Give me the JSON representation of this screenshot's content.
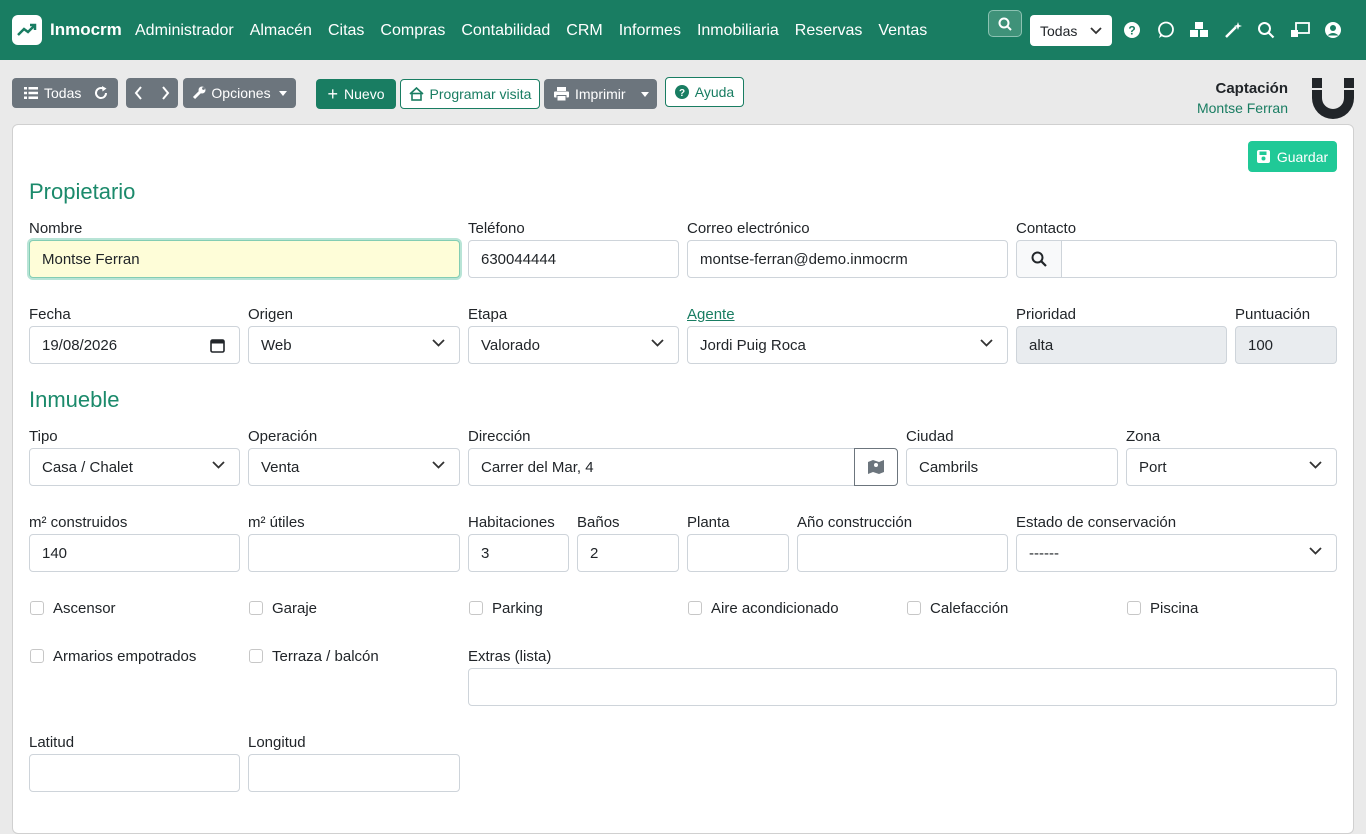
{
  "app": {
    "name": "Inmocrm"
  },
  "nav": [
    "Administrador",
    "Almacén",
    "Citas",
    "Compras",
    "Contabilidad",
    "CRM",
    "Informes",
    "Inmobiliaria",
    "Reservas",
    "Ventas"
  ],
  "top_select": "Todas",
  "toolbar": {
    "todas": "Todas",
    "opciones": "Opciones",
    "nuevo": "Nuevo",
    "programar": "Programar visita",
    "imprimir": "Imprimir",
    "ayuda": "Ayuda"
  },
  "header": {
    "title": "Captación",
    "subtitle": "Montse Ferran"
  },
  "save_label": "Guardar",
  "propietario": {
    "title": "Propietario",
    "nombre_label": "Nombre",
    "nombre": "Montse Ferran",
    "telefono_label": "Teléfono",
    "telefono": "630044444",
    "correo_label": "Correo electrónico",
    "correo": "montse-ferran@demo.inmocrm",
    "contacto_label": "Contacto",
    "contacto": "",
    "fecha_label": "Fecha",
    "fecha": "19/08/2026",
    "origen_label": "Origen",
    "origen": "Web",
    "etapa_label": "Etapa",
    "etapa": "Valorado",
    "agente_label": "Agente",
    "agente": "Jordi Puig Roca",
    "prioridad_label": "Prioridad",
    "prioridad": "alta",
    "puntuacion_label": "Puntuación",
    "puntuacion": "100"
  },
  "inmueble": {
    "title": "Inmueble",
    "tipo_label": "Tipo",
    "tipo": "Casa / Chalet",
    "operacion_label": "Operación",
    "operacion": "Venta",
    "direccion_label": "Dirección",
    "direccion": "Carrer del Mar, 4",
    "ciudad_label": "Ciudad",
    "ciudad": "Cambrils",
    "zona_label": "Zona",
    "zona": "Port",
    "m2c_label": "m² construidos",
    "m2c": "140",
    "m2u_label": "m² útiles",
    "m2u": "",
    "hab_label": "Habitaciones",
    "hab": "3",
    "banos_label": "Baños",
    "banos": "2",
    "planta_label": "Planta",
    "planta": "",
    "anio_label": "Año construcción",
    "anio": "",
    "estado_label": "Estado de conservación",
    "estado": "------",
    "checks": [
      "Ascensor",
      "Garaje",
      "Parking",
      "Aire acondicionado",
      "Calefacción",
      "Piscina",
      "Armarios empotrados",
      "Terraza / balcón"
    ],
    "extras_label": "Extras (lista)",
    "extras": "",
    "lat_label": "Latitud",
    "lat": "",
    "lon_label": "Longitud",
    "lon": ""
  },
  "colors": {
    "brand": "#197d62",
    "save": "#20c997"
  }
}
